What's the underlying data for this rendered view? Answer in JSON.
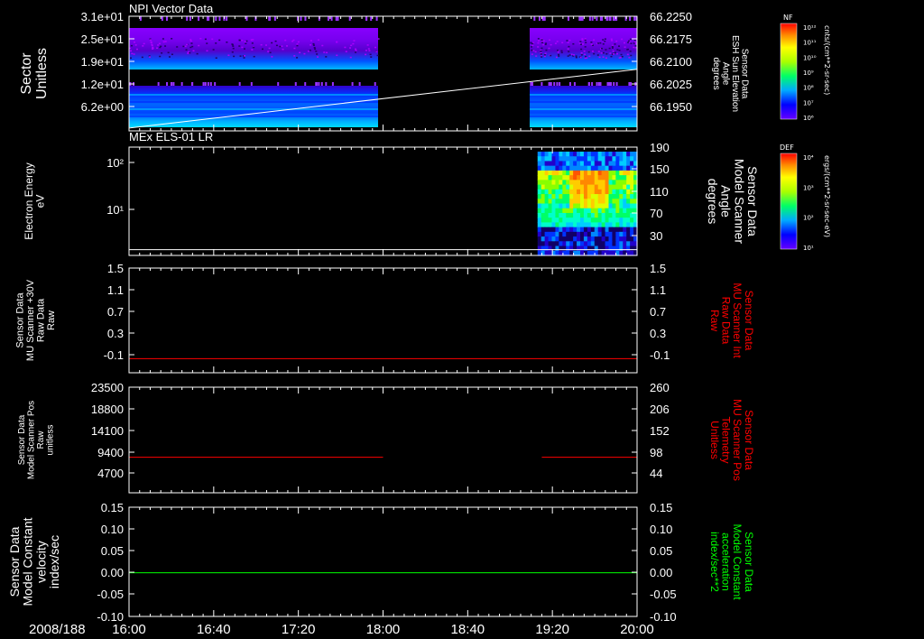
{
  "date_label": "2008/188",
  "time_ticks": [
    "16:00",
    "16:40",
    "17:20",
    "18:00",
    "18:40",
    "19:20",
    "20:00"
  ],
  "colors": {
    "axis": "#ffffff",
    "red": "#ff0000",
    "green": "#00ff00"
  },
  "panels": [
    {
      "title": "NPI Vector Data",
      "left_label": [
        "Sector",
        "Unitless"
      ],
      "left_ticks": [
        "3.1e+01",
        "2.5e+01",
        "1.9e+01",
        "1.2e+01",
        "6.2e+00"
      ],
      "right_label": [
        "Sensor Data",
        "ESH Sun Elevation",
        "Angle",
        "degrees"
      ],
      "right_ticks": [
        "66.2250",
        "66.2175",
        "66.2100",
        "66.2025",
        "66.1950"
      ],
      "colorbar_title": "NF",
      "colorbar_ticks": [
        "10¹²",
        "10¹¹",
        "10¹⁰",
        "10⁹",
        "10⁸",
        "10⁷",
        "10⁶"
      ],
      "colorbar_unit": "cnts/(cm**2-sr-sec)"
    },
    {
      "title": "MEx ELS-01 LR",
      "left_label": [
        "Electron Energy",
        "eV"
      ],
      "left_ticks": [
        "10²",
        "10¹"
      ],
      "right_label": [
        "Sensor Data",
        "Model Scanner",
        "Angle",
        "degrees"
      ],
      "right_ticks": [
        "190",
        "150",
        "110",
        "70",
        "30"
      ],
      "colorbar_title": "DEF",
      "colorbar_ticks": [
        "10⁴",
        "10³",
        "10²",
        "10¹"
      ],
      "colorbar_unit": "ergs/(cm**2-sr-sec-eV)"
    },
    {
      "left_label": [
        "Sensor Data",
        "MU Scanner +30V",
        "Raw Data",
        "Raw"
      ],
      "left_ticks": [
        "1.5",
        "1.1",
        "0.7",
        "0.3",
        "-0.1"
      ],
      "right_label": [
        "Sensor Data",
        "MU Scanner Int",
        "Raw Data",
        "Raw"
      ],
      "right_ticks": [
        "1.5",
        "1.1",
        "0.7",
        "0.3",
        "-0.1"
      ]
    },
    {
      "left_label": [
        "Sensor Data",
        "Model Scanner Pos",
        "Raw",
        "unitless"
      ],
      "left_ticks": [
        "23500",
        "18800",
        "14100",
        "9400",
        "4700"
      ],
      "right_label": [
        "Sensor Data",
        "MU Scanner Pos",
        "Telemetry",
        "Unitless"
      ],
      "right_ticks": [
        "260",
        "206",
        "152",
        "98",
        "44"
      ]
    },
    {
      "left_label": [
        "Sensor Data",
        "Model Constant",
        "velocity",
        "index/sec"
      ],
      "left_ticks": [
        "0.15",
        "0.10",
        "0.05",
        "0.00",
        "-0.05",
        "-0.10"
      ],
      "right_label": [
        "Sensor Data",
        "Model Constant",
        "acceleration",
        "index/sec**2"
      ],
      "right_ticks": [
        "0.15",
        "0.10",
        "0.05",
        "0.00",
        "-0.05",
        "-0.10"
      ]
    }
  ],
  "chart_data": [
    {
      "type": "heatmap",
      "title": "NPI Vector Data",
      "ylabel": "Sector Unitless",
      "y_ticks": [
        31,
        25,
        19,
        12,
        6.2
      ],
      "data_gaps": [
        [
          "17:58",
          "19:12"
        ]
      ],
      "overlay_line": {
        "name": "Sensor Data ESH Sun Elevation Angle degrees",
        "x": [
          "16:00",
          "20:00"
        ],
        "y": [
          66.191,
          66.2115
        ],
        "ylim": [
          66.19,
          66.23
        ]
      }
    },
    {
      "type": "heatmap",
      "title": "MEx ELS-01 LR",
      "ylabel": "Electron Energy eV",
      "yscale": "log",
      "data_range": [
        "19:13",
        "20:00"
      ],
      "overlay_line": {
        "name": "Sensor Data Model Scanner Angle degrees",
        "x": [
          "16:00",
          "20:00"
        ],
        "y": [
          10,
          10
        ],
        "ylim": [
          0,
          190
        ]
      }
    },
    {
      "type": "line",
      "series": [
        {
          "name": "Sensor Data MU Scanner +30V Raw Data Raw",
          "x": [
            "16:00",
            "20:00"
          ],
          "y": [
            -0.1,
            -0.1
          ]
        }
      ],
      "ylim": [
        -0.35,
        1.5
      ]
    },
    {
      "type": "line",
      "series": [
        {
          "name": "Sensor Data Model Scanner Pos Raw unitless",
          "segments": [
            {
              "x": [
                "16:00",
                "18:00"
              ],
              "y": [
                7900,
                7900
              ]
            },
            {
              "x": [
                "19:15",
                "20:00"
              ],
              "y": [
                7900,
                7900
              ]
            }
          ]
        }
      ],
      "ylim": [
        0,
        23500
      ]
    },
    {
      "type": "line",
      "series": [
        {
          "name": "Sensor Data Model Constant velocity index/sec",
          "x": [
            "16:00",
            "20:00"
          ],
          "y": [
            0.0,
            0.0
          ]
        }
      ],
      "ylim": [
        -0.1,
        0.15
      ]
    }
  ]
}
